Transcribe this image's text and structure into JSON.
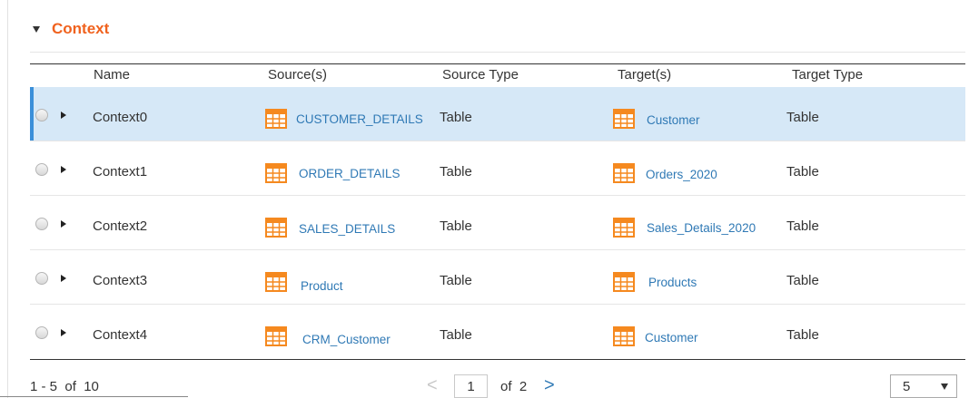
{
  "section": {
    "title": "Context"
  },
  "columns": {
    "name": "Name",
    "sources": "Source(s)",
    "source_type": "Source Type",
    "targets": "Target(s)",
    "target_type": "Target Type"
  },
  "rows": [
    {
      "name": "Context0",
      "source": "CUSTOMER_DETAILS",
      "source_type": "Table",
      "target": "Customer",
      "target_type": "Table",
      "selected": true
    },
    {
      "name": "Context1",
      "source": "ORDER_DETAILS",
      "source_type": "Table",
      "target": "Orders_2020",
      "target_type": "Table",
      "selected": false
    },
    {
      "name": "Context2",
      "source": "SALES_DETAILS",
      "source_type": "Table",
      "target": "Sales_Details_2020",
      "target_type": "Table",
      "selected": false
    },
    {
      "name": "Context3",
      "source": "Product",
      "source_type": "Table",
      "target": "Products",
      "target_type": "Table",
      "selected": false
    },
    {
      "name": "Context4",
      "source": "CRM_Customer",
      "source_type": "Table",
      "target": "Customer",
      "target_type": "Table",
      "selected": false
    }
  ],
  "pagination": {
    "range_text": "1 - 5  of  10",
    "prev": "<",
    "current_page": "1",
    "of_text": "of  2",
    "next": ">",
    "page_size": "5"
  },
  "icons": {
    "table": "table-icon",
    "expand": "caret-right-icon",
    "collapse": "caret-down-icon"
  },
  "colors": {
    "accent": "#f0621e",
    "link": "#2f79b5",
    "icon": "#f5891f",
    "selected_row": "#d6e8f7",
    "selected_indicator": "#3b8fd9"
  }
}
